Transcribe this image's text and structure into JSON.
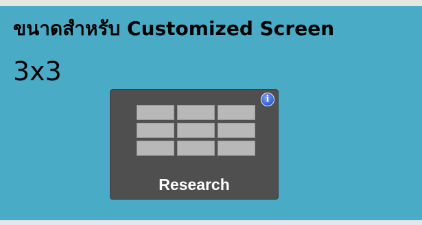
{
  "header": {
    "title": "ขนาดสำหรับ Customized Screen"
  },
  "size": {
    "value": "3x3"
  },
  "tile": {
    "label": "Research",
    "info_icon": "info-icon",
    "info_glyph": "i",
    "grid": {
      "rows": 3,
      "columns": 3
    }
  },
  "colors": {
    "panel_background": "#4aabc6",
    "tile_background": "#4f4f4f",
    "grid_cell": "#b8b8b8",
    "info_badge": "#2f5fd8"
  }
}
